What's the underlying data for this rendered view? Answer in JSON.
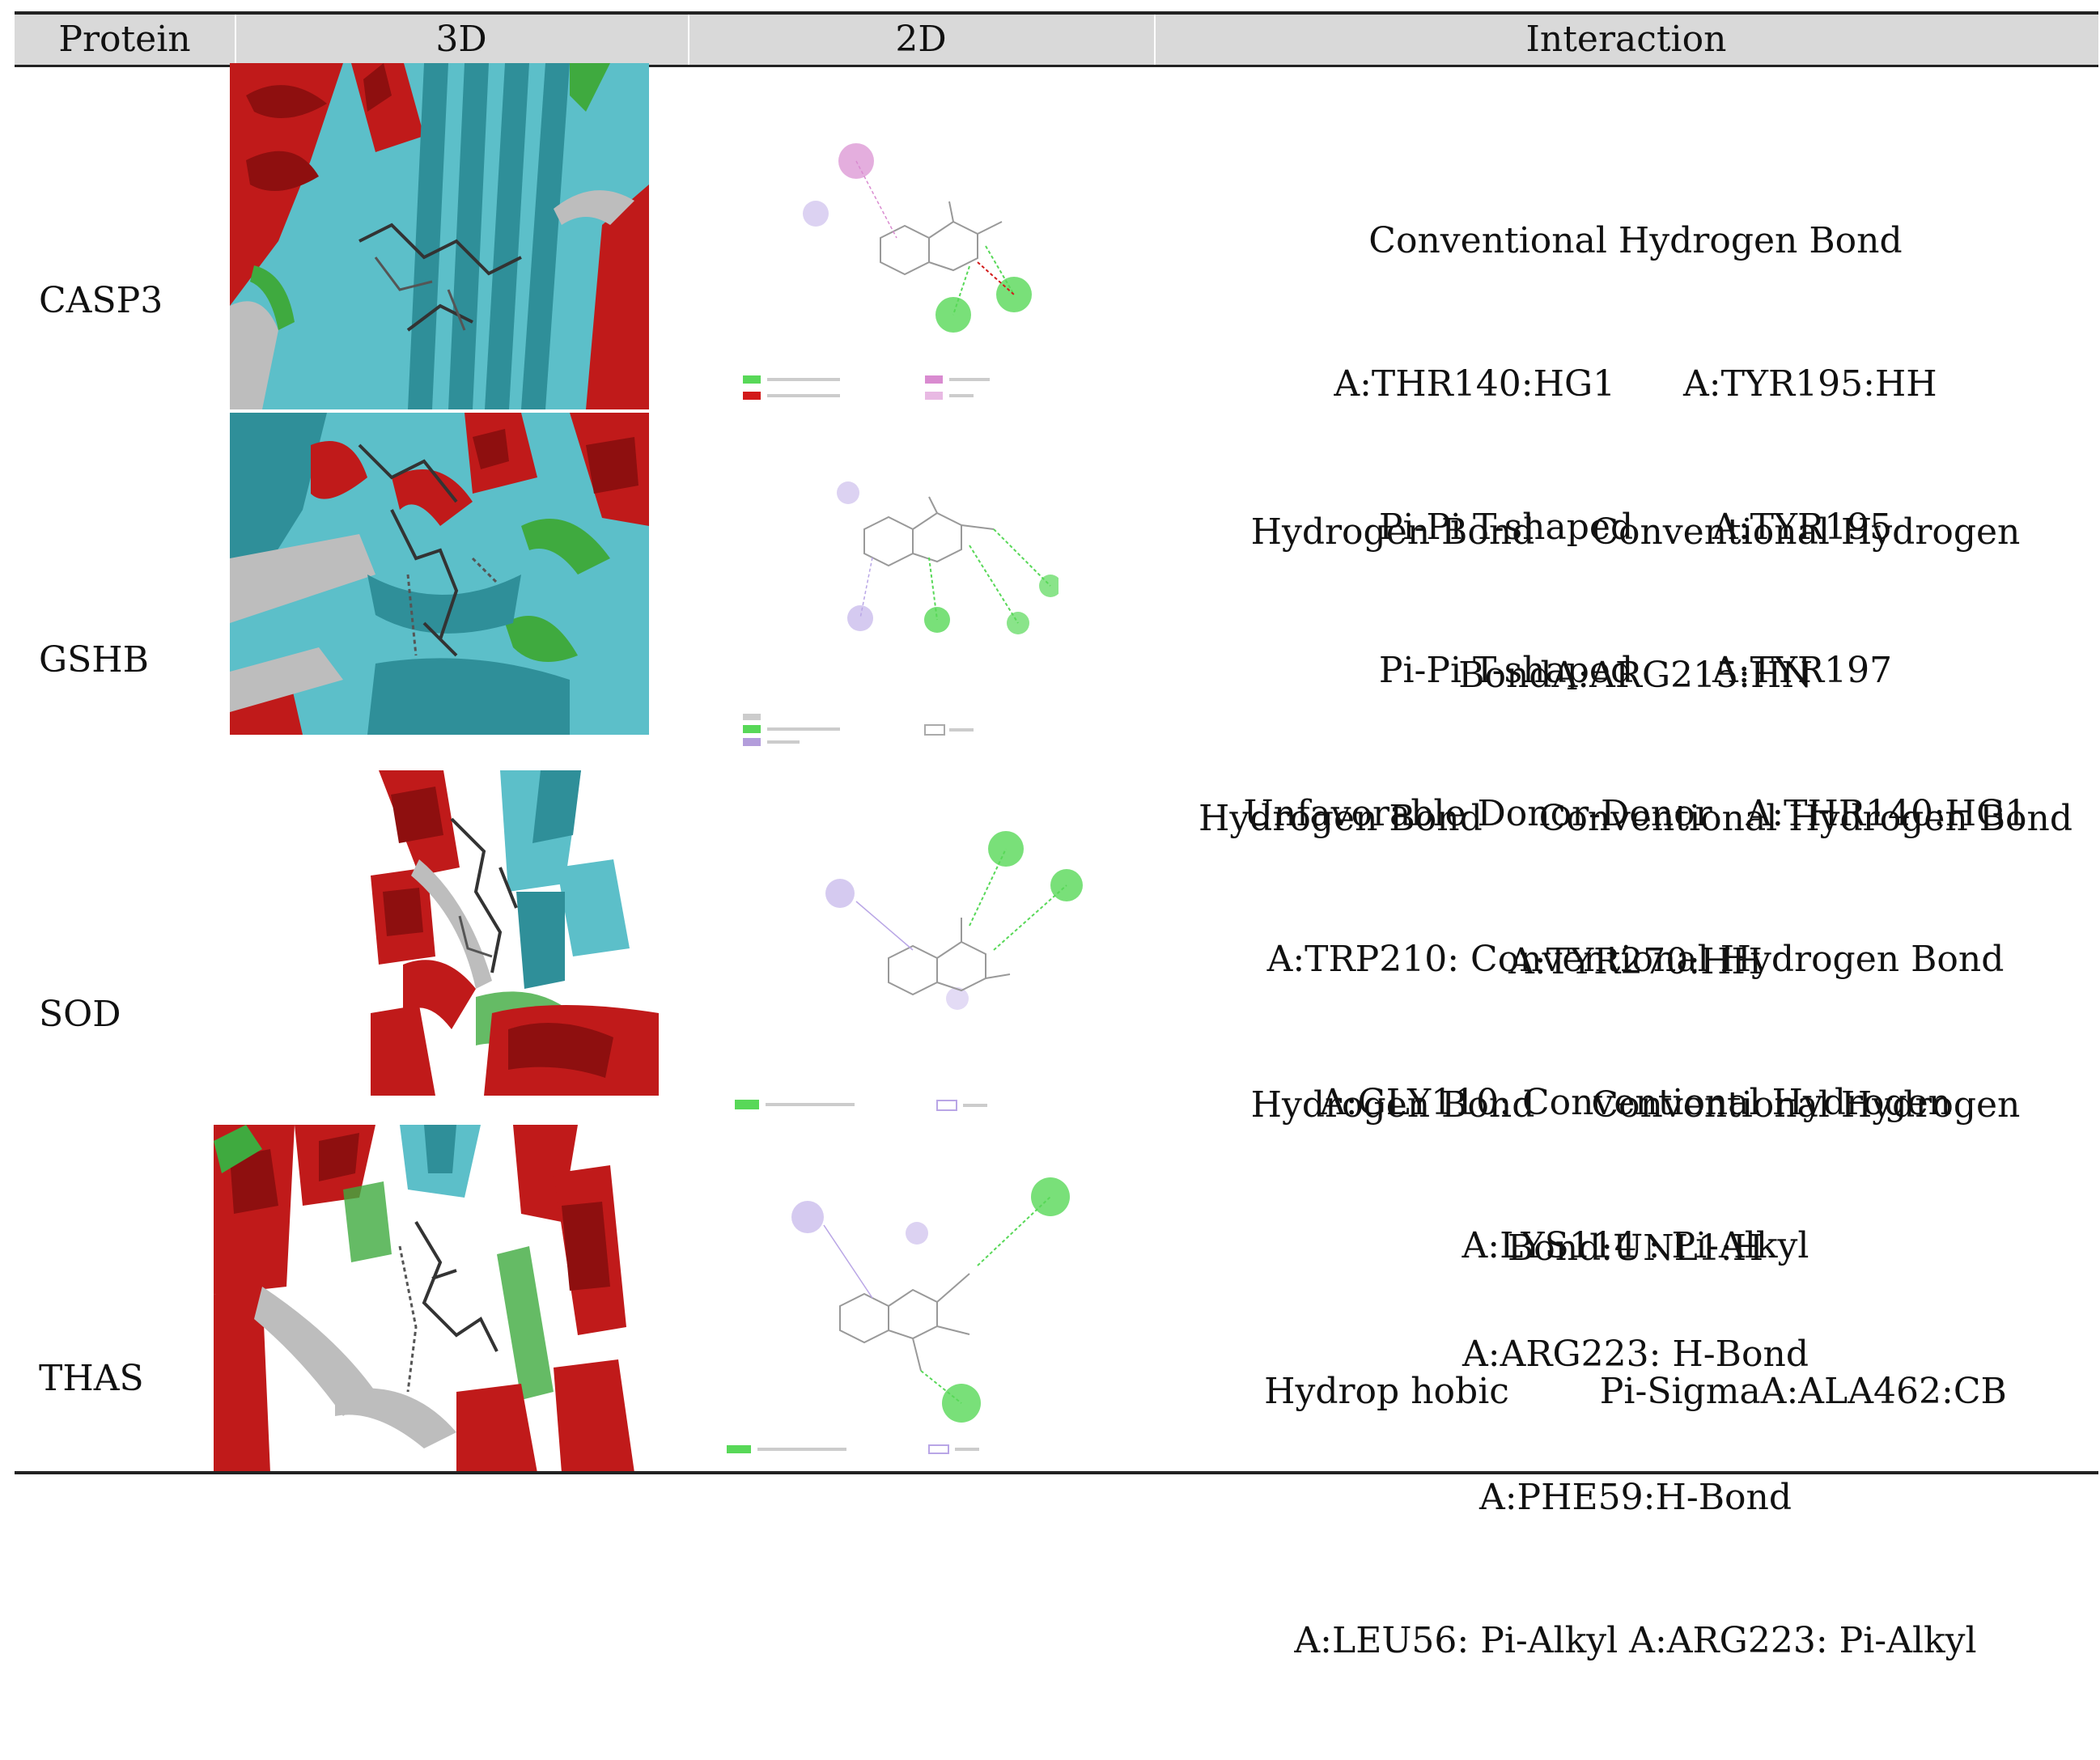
{
  "table": {
    "headers": [
      "Protein",
      "3D",
      "2D",
      "Interaction"
    ],
    "rows": [
      {
        "protein": "CASP3",
        "interaction_lines": [
          "Conventional Hydrogen Bond",
          "A:THR140:HG1      A:TYR195:HH",
          "Pi-Pi T-shaped       A:TYR195",
          "Pi-Pi T-shaped       A:TYR197",
          "Unfavorable Donor-Donor   A:THR140:HG1"
        ]
      },
      {
        "protein": "GSHB",
        "interaction_lines": [
          "Hydrogen Bond     Conventional Hydrogen",
          "BondA:ARG215:HN",
          "Hydrogen Bond     Conventional Hydrogen Bond",
          "A:TYR270:HH",
          "Hydrogen Bond     Conventional Hydrogen",
          "Bond:UNL1:H",
          "Hydrop hobic        Pi-SigmaA:ALA462:CB"
        ]
      },
      {
        "protein": "SOD",
        "interaction_lines": [
          "A:TRP210: Conventional Hydrogen Bond",
          "A:GLY110: Conventional Hydrogen",
          "A:LYS114 : Pi-Alkyl"
        ]
      },
      {
        "protein": "THAS",
        "interaction_lines": [
          "A:ARG223: H-Bond",
          "A:PHE59:H-Bond",
          "A:LEU56: Pi-Alkyl A:ARG223: Pi-Alkyl"
        ]
      }
    ]
  },
  "colors": {
    "header_bg": "#d9d9d9",
    "helix_red": "#c01a1a",
    "sheet_cyan": "#5cbfc9",
    "coil_gray": "#bdbdbd",
    "loop_green": "#3faa3f",
    "hbond_green": "#58d858",
    "pi_purple": "#b9a6e6",
    "pi_pink": "#d98bd0"
  }
}
